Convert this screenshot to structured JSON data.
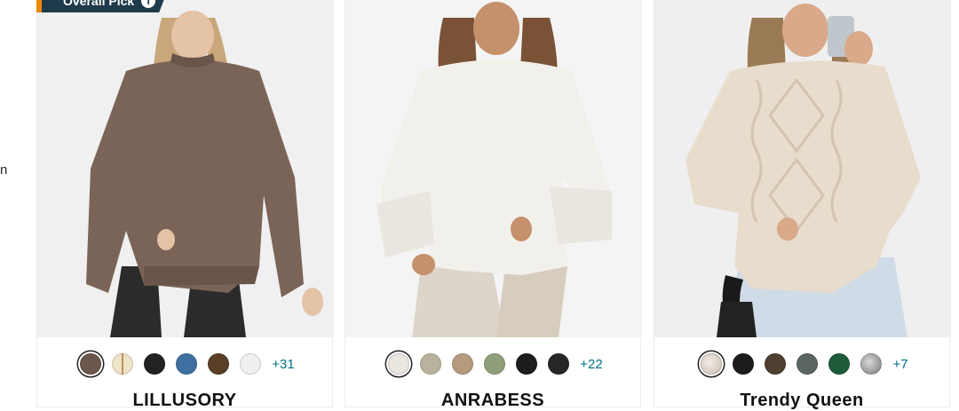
{
  "badge": {
    "label": "Overall Pick",
    "icon": "info-icon"
  },
  "side_fragment": "n",
  "cards": [
    {
      "brand": "LILLUSORY",
      "image_alt": "Model wearing brown oversized crewneck sweater",
      "swatch_colors": [
        "#6b574c",
        "#d9c39a",
        "#222222",
        "#3f6fa0",
        "#5a3e26",
        "#eef0f0"
      ],
      "more": "+31"
    },
    {
      "brand": "ANRABESS",
      "image_alt": "Model wearing white oversized crewneck sweater",
      "swatch_colors": [
        "#ebe5e0",
        "#b9b29f",
        "#b59b7e",
        "#8f9f7b",
        "#1c1c1c",
        "#262626"
      ],
      "more": "+22"
    },
    {
      "brand": "Trendy Queen",
      "image_alt": "Model wearing beige cable knit sweater",
      "swatch_colors": [
        "#d8ccc0",
        "#1c1c1c",
        "#4f3f30",
        "#5b6660",
        "#1e5b3a",
        "#9c9c9c"
      ],
      "more": "+7"
    }
  ]
}
